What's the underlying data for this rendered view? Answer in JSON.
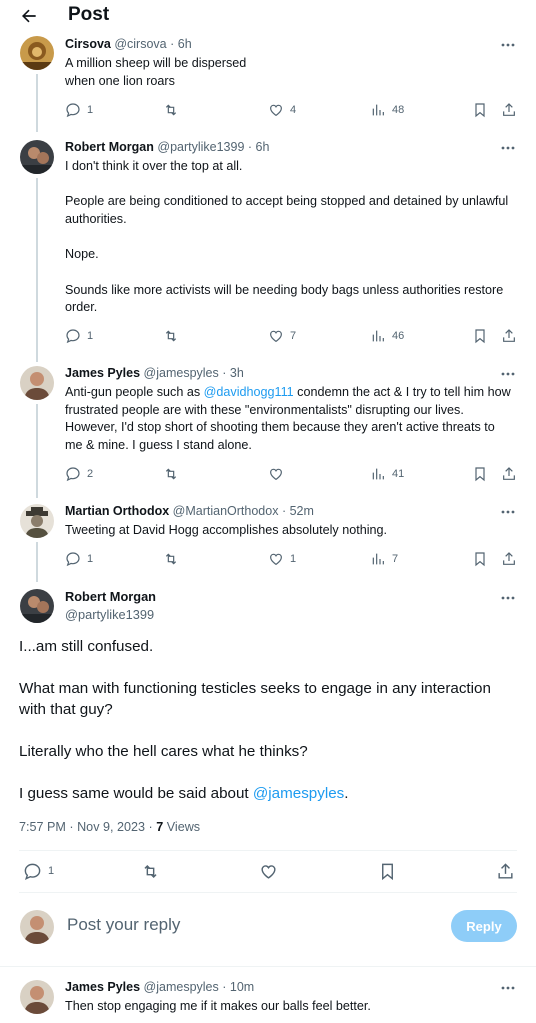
{
  "header": {
    "title": "Post"
  },
  "thread": [
    {
      "name": "Cirsova",
      "handle": "@cirsova",
      "time": "· 6h",
      "paragraphs": [
        "A million sheep will be dispersed\nwhen one lion roars"
      ],
      "replies": "1",
      "retweets": "",
      "likes": "4",
      "views": "48"
    },
    {
      "name": "Robert Morgan",
      "handle": "@partylike1399",
      "time": "· 6h",
      "paragraphs": [
        "I don't think it over the top at all.",
        "People are being conditioned to accept being stopped and detained by unlawful authorities.",
        "Nope.",
        "Sounds like more activists will be needing body bags unless authorities restore order."
      ],
      "replies": "1",
      "retweets": "",
      "likes": "7",
      "views": "46"
    },
    {
      "name": "James Pyles",
      "handle": "@jamespyles",
      "time": "· 3h",
      "text_before": "Anti-gun people such as ",
      "mention": "@davidhogg111",
      "text_after": " condemn the act & I try to tell him how frustrated people are with these \"environmentalists\" disrupting our lives. However, I'd stop short of shooting them because they aren't active threats to me & mine. I guess I stand alone.",
      "replies": "2",
      "retweets": "",
      "likes": "",
      "views": "41"
    },
    {
      "name": "Martian Orthodox",
      "handle": "@MartianOrthodox",
      "time": "· 52m",
      "paragraphs": [
        "Tweeting at David Hogg accomplishes absolutely nothing."
      ],
      "replies": "1",
      "retweets": "",
      "likes": "1",
      "views": "7"
    }
  ],
  "main": {
    "name": "Robert Morgan",
    "handle": "@partylike1399",
    "paragraphs": [
      "I...am still confused.",
      "What man with functioning testicles seeks to engage in any interaction with that guy?",
      "Literally who the hell cares what he thinks?"
    ],
    "last_before": "I guess same would be said about ",
    "last_mention": "@jamespyles",
    "last_after": ".",
    "timestamp": "7:57 PM · Nov 9, 2023 · ",
    "views_count": "7",
    "views_label": " Views",
    "replies": "1"
  },
  "reply_bar": {
    "placeholder": "Post your reply",
    "button": "Reply"
  },
  "bottom_reply": {
    "name": "James Pyles",
    "handle": "@jamespyles",
    "time": "· 10m",
    "text": "Then stop engaging me if it makes our balls feel better."
  },
  "colors": {
    "accent": "#1d9bf0",
    "secondary_text": "#536471",
    "reply_button": "#8ecdf8"
  }
}
